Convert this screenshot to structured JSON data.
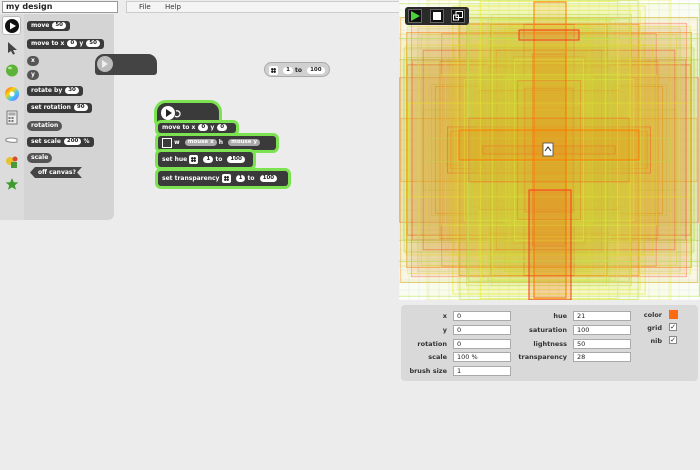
{
  "app": {
    "title": "my design",
    "menu": [
      "File",
      "Help"
    ]
  },
  "toolbar": {
    "icons": [
      "run-icon",
      "cursor-icon",
      "ball-icon",
      "color-wheel-icon",
      "calculator-icon",
      "hand-icon",
      "shapes-icon",
      "star-icon"
    ]
  },
  "palette": {
    "move_label": "move",
    "move_value": "50",
    "move_to_label": "move to x",
    "move_to_x": "0",
    "move_to_y_label": "y",
    "move_to_y": "50",
    "x_label": "x",
    "y_label": "y",
    "rotate_label": "rotate by",
    "rotate_value": "30",
    "set_rotation_label": "set rotation",
    "set_rotation_value": "90",
    "rotation_label": "rotation",
    "set_scale_label": "set scale",
    "set_scale_value": "200",
    "set_scale_unit": "%",
    "scale_label": "scale",
    "off_canvas_label": "off canvas?"
  },
  "workspace": {
    "floating_random": {
      "from": "1",
      "to_label": "to",
      "to": "100"
    },
    "script": {
      "move_to_label": "move to x",
      "x": "0",
      "y_label": "y",
      "y": "0",
      "rect_w_label": "w",
      "rect_w_value": "mouse x",
      "rect_h_label": "h",
      "rect_h_value": "mouse y",
      "set_hue_label": "set hue",
      "hue_from": "1",
      "hue_to_label": "to",
      "hue_to": "100",
      "set_transparency_label": "set transparency",
      "tr_from": "1",
      "tr_to_label": "to",
      "tr_to": "100"
    }
  },
  "stage": {
    "controls": [
      "run-button",
      "stop-button",
      "fullscreen-button"
    ],
    "colors": {
      "orange": "#ff7a00",
      "red": "#ff3322",
      "yellow": "#e8ee3a",
      "green": "#b6e05a"
    }
  },
  "properties": {
    "x_label": "x",
    "x": "0",
    "y_label": "y",
    "y": "0",
    "rotation_label": "rotation",
    "rotation": "0",
    "scale_label": "scale",
    "scale": "100 %",
    "brush_size_label": "brush size",
    "brush_size": "1",
    "hue_label": "hue",
    "hue": "21",
    "saturation_label": "saturation",
    "saturation": "100",
    "lightness_label": "lightness",
    "lightness": "50",
    "transparency_label": "transparency",
    "transparency": "28",
    "color_label": "color",
    "color_swatch": "#ff6a10",
    "grid_label": "grid",
    "grid_checked": "✓",
    "nib_label": "nib",
    "nib_checked": "✓"
  }
}
